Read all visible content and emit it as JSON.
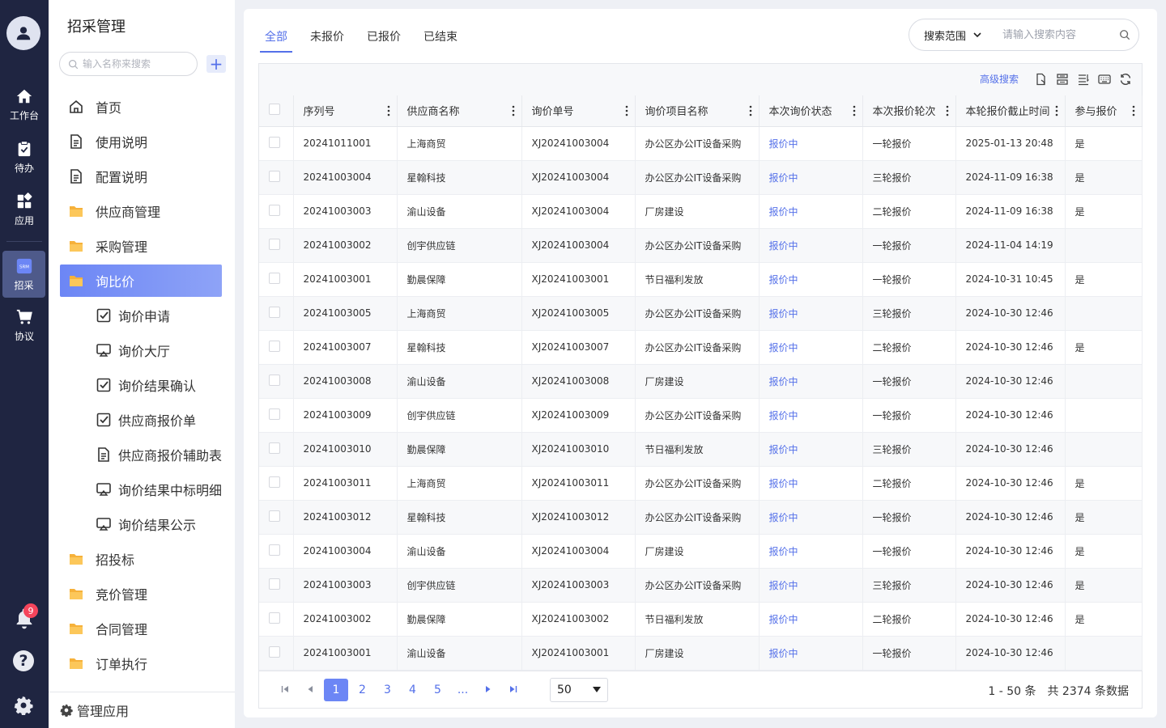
{
  "rail": {
    "items": [
      {
        "label": "工作台"
      },
      {
        "label": "待办"
      },
      {
        "label": "应用"
      },
      {
        "label": "招采",
        "badge_text": "SRM"
      },
      {
        "label": "协议"
      }
    ],
    "notification_count": "9",
    "help_glyph": "?"
  },
  "nav": {
    "title": "招采管理",
    "search_placeholder": "输入名称来搜索",
    "add_glyph": "+",
    "items": [
      {
        "label": "首页",
        "icon": "home-outline-icon"
      },
      {
        "label": "使用说明",
        "icon": "document-icon"
      },
      {
        "label": "配置说明",
        "icon": "document-icon"
      },
      {
        "label": "供应商管理",
        "icon": "folder-icon"
      },
      {
        "label": "采购管理",
        "icon": "folder-icon"
      },
      {
        "label": "询比价",
        "icon": "folder-icon"
      }
    ],
    "sub_items": [
      {
        "label": "询价申请",
        "icon": "checkbox-icon"
      },
      {
        "label": "询价大厅",
        "icon": "monitor-icon"
      },
      {
        "label": "询价结果确认",
        "icon": "checkbox-icon"
      },
      {
        "label": "供应商报价单",
        "icon": "checkbox-icon"
      },
      {
        "label": "供应商报价辅助表",
        "icon": "document-icon"
      },
      {
        "label": "询价结果中标明细",
        "icon": "monitor-icon"
      },
      {
        "label": "询价结果公示",
        "icon": "monitor-icon"
      }
    ],
    "more_items": [
      {
        "label": "招投标"
      },
      {
        "label": "竞价管理"
      },
      {
        "label": "合同管理"
      },
      {
        "label": "订单执行"
      }
    ],
    "footer": "管理应用"
  },
  "tabs": [
    "全部",
    "未报价",
    "已报价",
    "已结束"
  ],
  "search": {
    "scope_label": "搜索范围",
    "placeholder": "请输入搜索内容"
  },
  "toolbar": {
    "advanced_search": "高级搜索"
  },
  "table": {
    "headers": [
      "序列号",
      "供应商名称",
      "询价单号",
      "询价项目名称",
      "本次询价状态",
      "本次报价轮次",
      "本轮报价截止时间",
      "参与报价"
    ],
    "rows": [
      [
        "20241011001",
        "上海商贸",
        "XJ20241003004",
        "办公区办公IT设备采购",
        "报价中",
        "一轮报价",
        "2025-01-13 20:48",
        "是"
      ],
      [
        "20241003004",
        "星翰科技",
        "XJ20241003004",
        "办公区办公IT设备采购",
        "报价中",
        "三轮报价",
        "2024-11-09 16:38",
        "是"
      ],
      [
        "20241003003",
        "渝山设备",
        "XJ20241003004",
        "厂房建设",
        "报价中",
        "二轮报价",
        "2024-11-09 16:38",
        "是"
      ],
      [
        "20241003002",
        "创宇供应链",
        "XJ20241003004",
        "办公区办公IT设备采购",
        "报价中",
        "一轮报价",
        "2024-11-04 14:19",
        ""
      ],
      [
        "20241003001",
        "勤晨保障",
        "XJ20241003001",
        "节日福利发放",
        "报价中",
        "一轮报价",
        "2024-10-31 10:45",
        "是"
      ],
      [
        "20241003005",
        "上海商贸",
        "XJ20241003005",
        "办公区办公IT设备采购",
        "报价中",
        "三轮报价",
        "2024-10-30 12:46",
        ""
      ],
      [
        "20241003007",
        "星翰科技",
        "XJ20241003007",
        "办公区办公IT设备采购",
        "报价中",
        "二轮报价",
        "2024-10-30 12:46",
        "是"
      ],
      [
        "20241003008",
        "渝山设备",
        "XJ20241003008",
        "厂房建设",
        "报价中",
        "一轮报价",
        "2024-10-30 12:46",
        ""
      ],
      [
        "20241003009",
        "创宇供应链",
        "XJ20241003009",
        "办公区办公IT设备采购",
        "报价中",
        "一轮报价",
        "2024-10-30 12:46",
        ""
      ],
      [
        "20241003010",
        "勤晨保障",
        "XJ20241003010",
        "节日福利发放",
        "报价中",
        "三轮报价",
        "2024-10-30 12:46",
        ""
      ],
      [
        "20241003011",
        "上海商贸",
        "XJ20241003011",
        "办公区办公IT设备采购",
        "报价中",
        "二轮报价",
        "2024-10-30 12:46",
        "是"
      ],
      [
        "20241003012",
        "星翰科技",
        "XJ20241003012",
        "办公区办公IT设备采购",
        "报价中",
        "一轮报价",
        "2024-10-30 12:46",
        "是"
      ],
      [
        "20241003004",
        "渝山设备",
        "XJ20241003004",
        "厂房建设",
        "报价中",
        "一轮报价",
        "2024-10-30 12:46",
        "是"
      ],
      [
        "20241003003",
        "创宇供应链",
        "XJ20241003003",
        "办公区办公IT设备采购",
        "报价中",
        "三轮报价",
        "2024-10-30 12:46",
        "是"
      ],
      [
        "20241003002",
        "勤晨保障",
        "XJ20241003002",
        "节日福利发放",
        "报价中",
        "二轮报价",
        "2024-10-30 12:46",
        "是"
      ],
      [
        "20241003001",
        "渝山设备",
        "XJ20241003001",
        "厂房建设",
        "报价中",
        "一轮报价",
        "2024-10-30 12:46",
        ""
      ]
    ]
  },
  "pagination": {
    "pages": [
      "1",
      "2",
      "3",
      "4",
      "5",
      "..."
    ],
    "current": "1",
    "page_size": "50",
    "range": "1 - 50 条",
    "total": "共 2374 条数据"
  },
  "colors": {
    "accent": "#5470e9",
    "rail_bg": "#1f2541",
    "active_nav": "#6c86f5",
    "badge": "#f5455c",
    "folder": "#f6b13a"
  }
}
